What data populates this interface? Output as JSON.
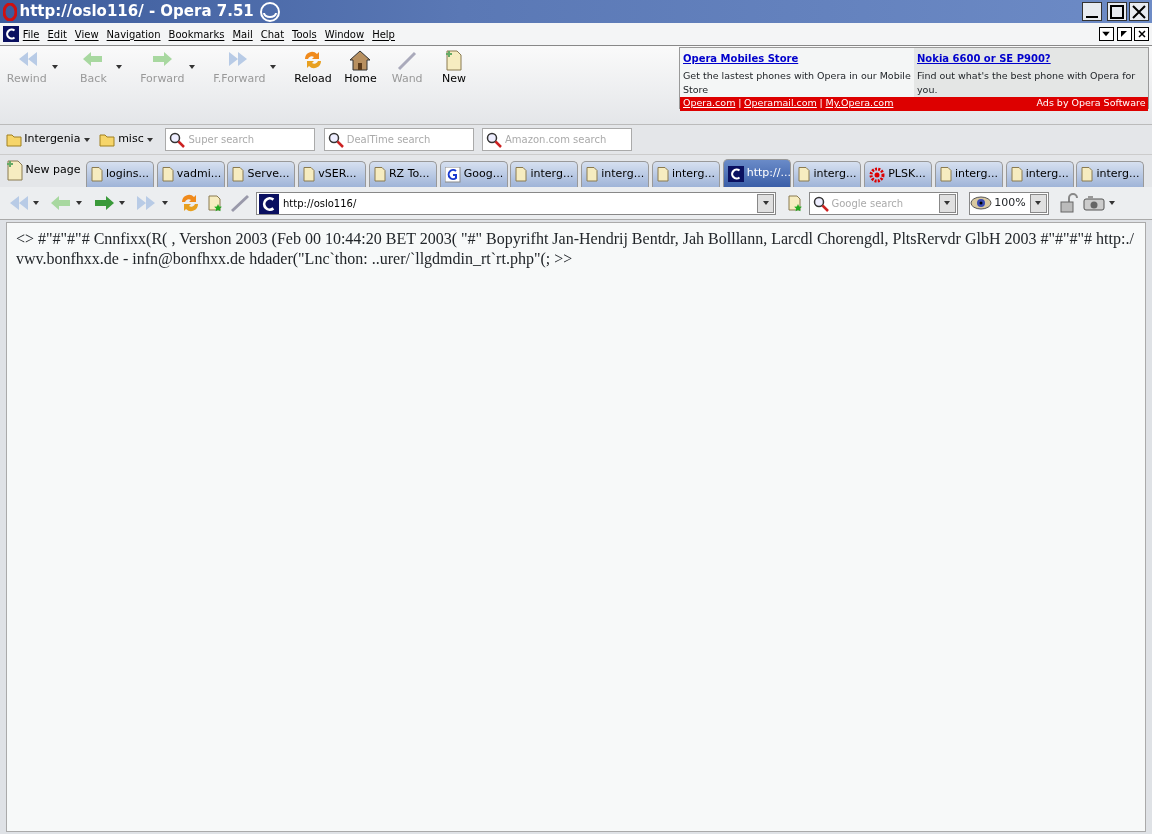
{
  "window": {
    "title": "http://oslo116/ - Opera 7.51"
  },
  "menu": [
    "File",
    "Edit",
    "View",
    "Navigation",
    "Bookmarks",
    "Mail",
    "Chat",
    "Tools",
    "Window",
    "Help"
  ],
  "toolbar": [
    {
      "label": "Rewind",
      "kind": "rewind",
      "disabled": true,
      "dropdown": true
    },
    {
      "label": "Back",
      "kind": "back",
      "disabled": true,
      "dropdown": true
    },
    {
      "label": "Forward",
      "kind": "forward",
      "disabled": true,
      "dropdown": true
    },
    {
      "label": "F.Forward",
      "kind": "fforward",
      "disabled": true,
      "dropdown": true
    },
    {
      "label": "Reload",
      "kind": "reload",
      "disabled": false,
      "dropdown": false
    },
    {
      "label": "Home",
      "kind": "home",
      "disabled": false,
      "dropdown": false
    },
    {
      "label": "Wand",
      "kind": "wand",
      "disabled": true,
      "dropdown": false
    },
    {
      "label": "New",
      "kind": "new",
      "disabled": false,
      "dropdown": false
    }
  ],
  "ads": [
    {
      "title": "Opera Mobiles Store",
      "body": "Get the lastest phones with Opera in our Mobile Store"
    },
    {
      "title": "Nokia 6600 or SE P900?",
      "body": "Find out what's the best phone with Opera for you."
    }
  ],
  "ad_links": [
    "Opera.com",
    "Operamail.com",
    "My.Opera.com"
  ],
  "ad_link_separator": "|",
  "ad_credit": "Ads by Opera Software",
  "bookmarks": [
    "Intergenia",
    "misc"
  ],
  "searches": [
    {
      "placeholder": "Super search"
    },
    {
      "placeholder": "DealTime search"
    },
    {
      "placeholder": "Amazon.com search"
    }
  ],
  "new_page": "New page",
  "tabs": [
    {
      "label": "logins...",
      "kind": "page",
      "selected": false
    },
    {
      "label": "vadmi...",
      "kind": "page",
      "selected": false
    },
    {
      "label": "Serve...",
      "kind": "page",
      "selected": false
    },
    {
      "label": "vSER...",
      "kind": "page",
      "selected": false
    },
    {
      "label": "RZ To...",
      "kind": "page",
      "selected": false
    },
    {
      "label": "Goog...",
      "kind": "google",
      "selected": false
    },
    {
      "label": "interg...",
      "kind": "page",
      "selected": false
    },
    {
      "label": "interg...",
      "kind": "page",
      "selected": false
    },
    {
      "label": "interg...",
      "kind": "page",
      "selected": false
    },
    {
      "label": "http://...",
      "kind": "opera",
      "selected": true
    },
    {
      "label": "interg...",
      "kind": "page",
      "selected": false
    },
    {
      "label": "PLSK...",
      "kind": "gear",
      "selected": false
    },
    {
      "label": "interg...",
      "kind": "page",
      "selected": false
    },
    {
      "label": "interg...",
      "kind": "page",
      "selected": false
    },
    {
      "label": "interg...",
      "kind": "page",
      "selected": false
    }
  ],
  "address": {
    "url": "http://oslo116/",
    "search_placeholder": "Google search",
    "zoom": "100%"
  },
  "page_text": "<> #\"#\"#\"# Cnnfixx(R( , Vershon 2003 (Feb 00 10:44:20 BET 2003( \"#\" Bopyrifht Jan-Hendrij Bentdr, Jah Bolllann, Larcdl Chorengdl, PltsRervdr GlbH 2003 #\"#\"#\"# http:./ vwv.bonfhxx.de - infn@bonfhxx.de hdader(\"Lnc`thon: ..urer/`llgdmdin_rt`rt.php\"(;  >>"
}
